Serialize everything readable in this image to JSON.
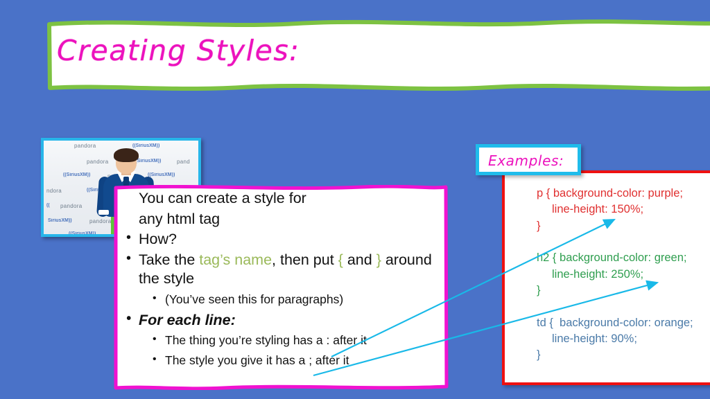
{
  "slide": {
    "background_color": "#4a72c8",
    "title": "Creating Styles:",
    "title_color": "#ec12bd",
    "banner_border_color": "#7dc242"
  },
  "photo": {
    "alt_name": "person-in-blue-sweater-photo",
    "border_color": "#27b6ea",
    "backdrop_logos": [
      "pandora",
      "SiriusXM",
      "pandora",
      "SiriusXM",
      "pand",
      "SiriusXM",
      "pandora",
      "SiriusXM",
      "SiriusX",
      "ndora",
      "Siriu",
      "pandora",
      "SiriusX",
      "pandora",
      "pandora",
      "pando",
      "SiriusXM",
      "SiriusXM",
      "SiriusXM",
      "SiriusXM"
    ]
  },
  "content": {
    "border_color": "#f012d0",
    "accent_color": "#9ab959",
    "bullets": [
      {
        "level": 1,
        "marker": false,
        "style": "normal",
        "parts": [
          {
            "text": "You can create a style for",
            "color": "normal"
          }
        ]
      },
      {
        "level": 1,
        "marker": false,
        "style": "normal",
        "parts": [
          {
            "text": "any html tag",
            "color": "normal"
          }
        ]
      },
      {
        "level": 1,
        "marker": true,
        "style": "normal",
        "parts": [
          {
            "text": "How?",
            "color": "normal"
          }
        ]
      },
      {
        "level": 1,
        "marker": true,
        "style": "normal",
        "parts": [
          {
            "text": "Take the ",
            "color": "normal"
          },
          {
            "text": "tag’s name",
            "color": "accent"
          },
          {
            "text": ", then put ",
            "color": "normal"
          },
          {
            "text": "{",
            "color": "accent"
          },
          {
            "text": " and ",
            "color": "normal"
          },
          {
            "text": "}",
            "color": "accent"
          },
          {
            "text": " around the style",
            "color": "normal"
          }
        ]
      },
      {
        "level": 2,
        "marker": true,
        "style": "normal",
        "parts": [
          {
            "text": "(You’ve seen this for paragraphs)",
            "color": "normal"
          }
        ]
      },
      {
        "level": 1,
        "marker": true,
        "style": "bolditalic",
        "parts": [
          {
            "text": "For each line:",
            "color": "normal"
          }
        ]
      },
      {
        "level": 2,
        "marker": true,
        "style": "normal",
        "parts": [
          {
            "text": "The thing you’re styling has a : after it",
            "color": "normal"
          }
        ]
      },
      {
        "level": 2,
        "marker": true,
        "style": "normal",
        "parts": [
          {
            "text": "The style you give it has a ; after it",
            "color": "normal"
          }
        ]
      }
    ]
  },
  "examples": {
    "label": "Examples:",
    "label_text_color": "#ec12bd",
    "label_border_color": "#1fbceb",
    "panel_border_color": "#ee1111",
    "arrow_color": "#19b9e8",
    "code_blocks": [
      {
        "name": "p-rule",
        "color": "#e03030",
        "line1": "p { background-color: purple;",
        "line2": "line-height: 150%;",
        "line3": "}"
      },
      {
        "name": "h2-rule",
        "color": "#2f9e4f",
        "line1": "h2 { background-color: green;",
        "line2": "line-height: 250%;",
        "line3": "}"
      },
      {
        "name": "td-rule",
        "color": "#4a7aa8",
        "line1": "td {  background-color: orange;",
        "line2": "line-height: 90%;",
        "line3": "}"
      }
    ]
  }
}
